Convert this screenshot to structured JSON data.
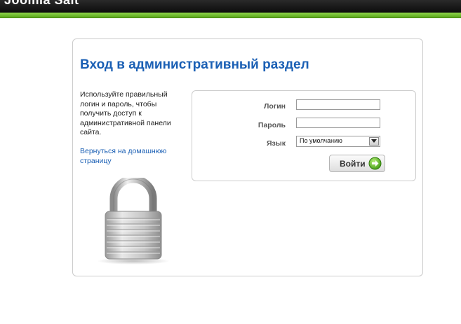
{
  "header": {
    "site_title": "Joomla Sait"
  },
  "login": {
    "title": "Вход в административный раздел",
    "help_text": "Используйте правильный логин и пароль, чтобы получить доступ к административной панели сайта.",
    "home_link": "Вернуться на домашнюю страницу",
    "username_label": "Логин",
    "username_value": "",
    "password_label": "Пароль",
    "password_value": "",
    "language_label": "Язык",
    "language_selected": "По умолчанию",
    "submit_label": "Войти"
  },
  "colors": {
    "accent_green": "#6cc12e",
    "title_blue": "#1a5fb4",
    "topbar": "#111111"
  },
  "icons": {
    "lock": "padlock-icon",
    "go": "green-arrow-circle-icon",
    "dropdown": "chevron-down-icon"
  }
}
